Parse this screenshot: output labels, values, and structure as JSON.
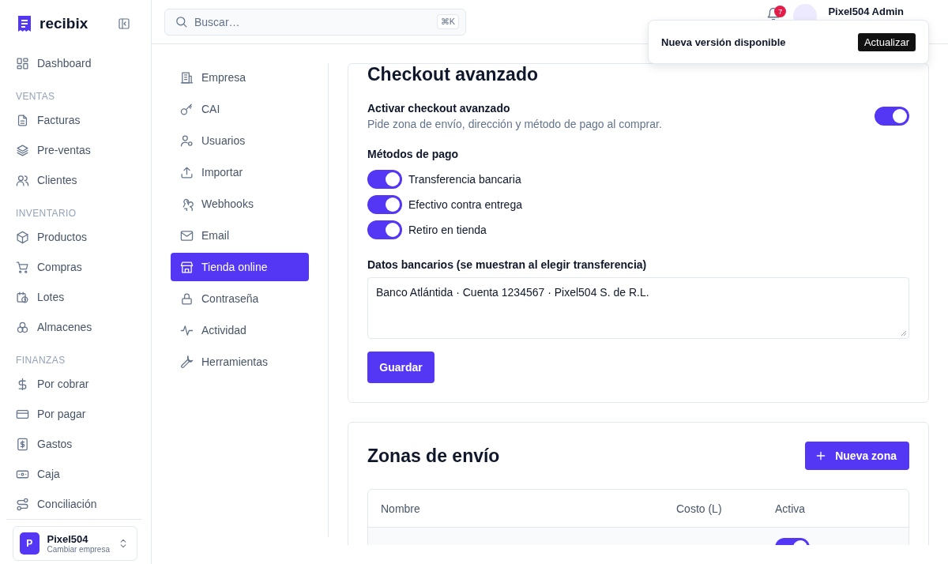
{
  "brand": {
    "name": "recibix"
  },
  "sidebar": {
    "sections": [
      {
        "items": [
          {
            "label": "Dashboard",
            "selected": false
          }
        ]
      },
      {
        "heading": "VENTAS",
        "items": [
          {
            "label": "Facturas",
            "selected": false
          },
          {
            "label": "Pre-ventas",
            "selected": false
          },
          {
            "label": "Clientes",
            "selected": false
          }
        ]
      },
      {
        "heading": "INVENTARIO",
        "items": [
          {
            "label": "Productos",
            "selected": false
          },
          {
            "label": "Compras",
            "selected": false
          },
          {
            "label": "Lotes",
            "selected": false
          },
          {
            "label": "Almacenes",
            "selected": false
          }
        ]
      },
      {
        "heading": "FINANZAS",
        "items": [
          {
            "label": "Por cobrar",
            "selected": false
          },
          {
            "label": "Por pagar",
            "selected": false
          },
          {
            "label": "Gastos",
            "selected": false
          },
          {
            "label": "Caja",
            "selected": false
          },
          {
            "label": "Conciliación",
            "selected": false
          }
        ]
      }
    ]
  },
  "workspace": {
    "initial": "P",
    "name": "Pixel504",
    "action": "Cambiar empresa"
  },
  "search": {
    "placeholder": "Buscar…",
    "shortcut": "⌘K"
  },
  "notifications": {
    "count": "7"
  },
  "user": {
    "name": "Pixel504 Admin"
  },
  "toast": {
    "message": "Nueva versión disponible",
    "action": "Actualizar"
  },
  "settings_nav": [
    {
      "label": "Empresa",
      "selected": false
    },
    {
      "label": "CAI",
      "selected": false
    },
    {
      "label": "Usuarios",
      "selected": false
    },
    {
      "label": "Importar",
      "selected": false
    },
    {
      "label": "Webhooks",
      "selected": false
    },
    {
      "label": "Email",
      "selected": false
    },
    {
      "label": "Tienda online",
      "selected": true
    },
    {
      "label": "Contraseña",
      "selected": false
    },
    {
      "label": "Actividad",
      "selected": false
    },
    {
      "label": "Herramientas",
      "selected": false
    }
  ],
  "checkout": {
    "title": "Checkout avanzado",
    "enable": {
      "label": "Activar checkout avanzado",
      "description": "Pide zona de envío, dirección y método de pago al comprar.",
      "on": true
    },
    "methods_heading": "Métodos de pago",
    "methods": [
      {
        "label": "Transferencia bancaria",
        "on": true
      },
      {
        "label": "Efectivo contra entrega",
        "on": true
      },
      {
        "label": "Retiro en tienda",
        "on": true
      }
    ],
    "bank_label": "Datos bancarios (se muestran al elegir transferencia)",
    "bank_value": "Banco Atlántida · Cuenta 1234567 · Pixel504 S. de R.L.",
    "save": "Guardar"
  },
  "zones": {
    "title": "Zonas de envío",
    "add": "Nueva zona",
    "columns": [
      "Nombre",
      "Costo (L)",
      "Activa"
    ],
    "rows": [
      {
        "active": true
      }
    ]
  }
}
